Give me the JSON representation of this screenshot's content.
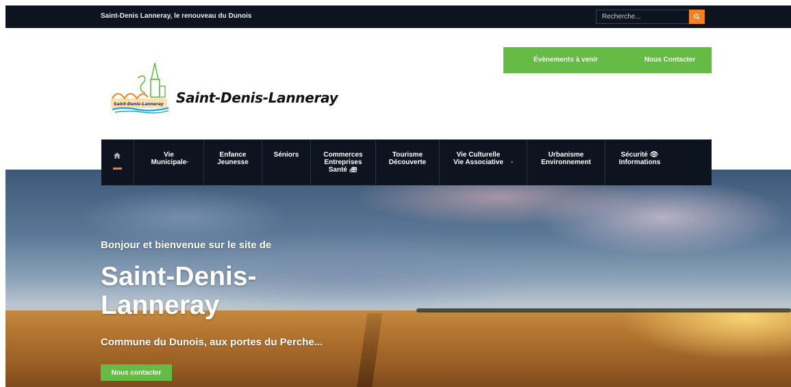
{
  "topbar": {
    "tagline": "Saint-Denis Lanneray, le renouveau du Dunois",
    "search_placeholder": "Recherche...",
    "search_icon": "search-icon"
  },
  "header": {
    "site_name": "Saint-Denis-Lanneray",
    "logo_text": "Saint-Denis-Lanneray",
    "cta": {
      "events_label": "Évènements à venir",
      "contact_label": "Nous Contacter"
    }
  },
  "nav": {
    "home_icon": "home-icon",
    "items": [
      {
        "label": "Vie\nMunicipale",
        "has_dropdown": true
      },
      {
        "label": "Enfance\nJeunesse",
        "has_dropdown": false
      },
      {
        "label": "Séniors",
        "has_dropdown": false
      },
      {
        "label": "Commerces\nEntreprises\nSanté 🚑",
        "has_dropdown": false
      },
      {
        "label": "Tourisme\nDécouverte",
        "has_dropdown": false
      },
      {
        "label": "Vie Culturelle\nVie Associative",
        "has_dropdown": true
      },
      {
        "label": "Urbanisme\nEnvironnement",
        "has_dropdown": false
      },
      {
        "label": "Sécurité 👁\nInformations",
        "has_dropdown": false
      }
    ]
  },
  "hero": {
    "intro": "Bonjour et bienvenue sur le site de",
    "title": "Saint-Denis-\nLanneray",
    "subtitle": "Commune du Dunois, aux portes du Perche...",
    "button_label": "Nous contacter"
  },
  "colors": {
    "dark": "#0d1420",
    "accent_orange": "#f58220",
    "accent_green": "#66bb46"
  }
}
